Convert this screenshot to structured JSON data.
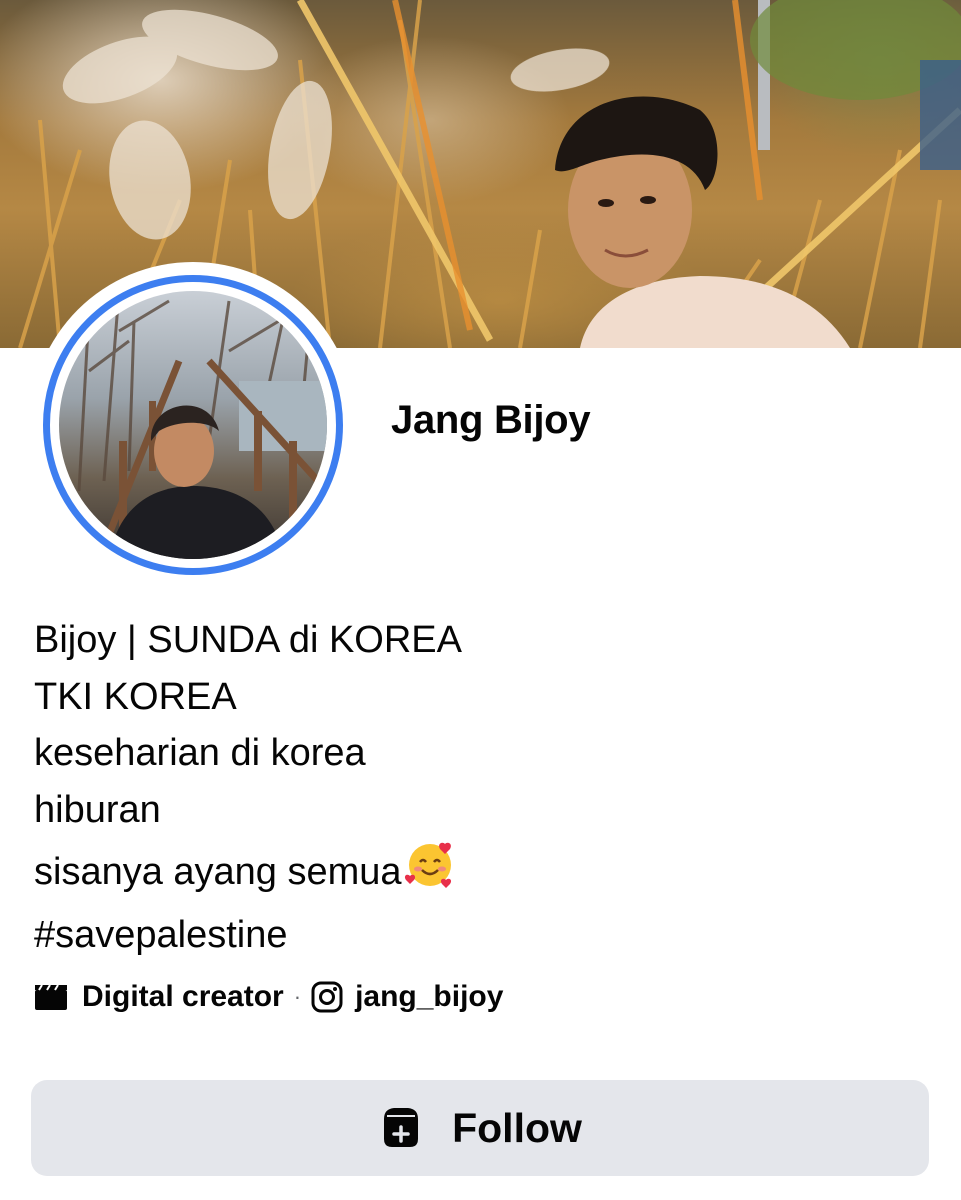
{
  "profile": {
    "name": "Jang Bijoy"
  },
  "bio": {
    "lines": [
      "Bijoy | SUNDA di KOREA",
      "TKI KOREA",
      "keseharian di korea",
      "hiburan",
      "sisanya ayang semua",
      "#savepalestine"
    ],
    "emoji_icon": "smiling-face-with-hearts-icon"
  },
  "meta": {
    "category": "Digital creator",
    "separator": "·",
    "instagram_handle": "jang_bijoy",
    "category_icon": "clapperboard-icon",
    "instagram_icon": "instagram-icon"
  },
  "actions": {
    "follow_label": "Follow",
    "follow_icon": "follow-plus-icon"
  },
  "colors": {
    "avatar_ring": "#3d7ef0",
    "button_bg": "#e4e6eb",
    "text": "#050505"
  }
}
